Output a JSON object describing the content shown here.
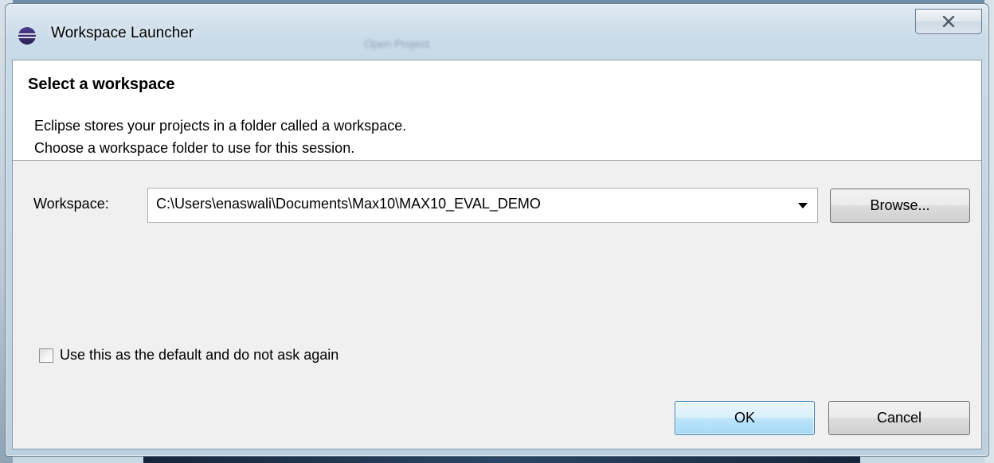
{
  "window": {
    "title": "Workspace Launcher",
    "background_hint": "Open Project"
  },
  "header": {
    "title": "Select a workspace",
    "description_line1": "Eclipse stores your projects in a folder called a workspace.",
    "description_line2": "Choose a workspace folder to use for this session."
  },
  "workspace": {
    "label": "Workspace:",
    "value": "C:\\Users\\enaswali\\Documents\\Max10\\MAX10_EVAL_DEMO"
  },
  "buttons": {
    "browse_label": "Browse...",
    "ok_label": "OK",
    "cancel_label": "Cancel"
  },
  "default_option": {
    "label": "Use this as the default and do not ask again",
    "checked": false
  },
  "icons": {
    "title": "eclipse-icon",
    "close": "close-icon",
    "dropdown": "chevron-down-icon"
  },
  "colors": {
    "ok_border": "#3c7fb1",
    "header_bg": "#ffffff",
    "client_bg": "#f0f0f0"
  }
}
